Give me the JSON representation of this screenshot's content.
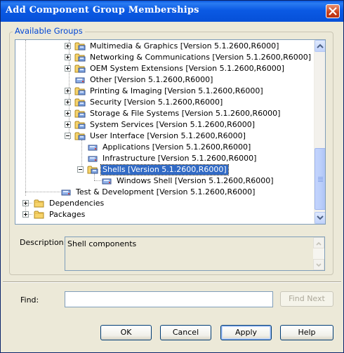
{
  "window": {
    "title": "Add Component Group Memberships"
  },
  "group": {
    "legend": "Available Groups"
  },
  "tree": {
    "items": [
      {
        "label": "Multimedia & Graphics [Version 5.1.2600,R6000]",
        "expander": "plus",
        "icon": "folder-component-icon"
      },
      {
        "label": "Networking & Communications [Version 5.1.2600,R6000]",
        "expander": "plus",
        "icon": "folder-component-icon"
      },
      {
        "label": "OEM System Extensions [Version 5.1.2600,R6000]",
        "expander": "plus",
        "icon": "folder-component-icon"
      },
      {
        "label": "Other [Version 5.1.2600,R6000]",
        "expander": "none",
        "icon": "component-icon"
      },
      {
        "label": "Printing & Imaging [Version 5.1.2600,R6000]",
        "expander": "plus",
        "icon": "folder-component-icon"
      },
      {
        "label": "Security [Version 5.1.2600,R6000]",
        "expander": "plus",
        "icon": "folder-component-icon"
      },
      {
        "label": "Storage & File Systems [Version 5.1.2600,R6000]",
        "expander": "plus",
        "icon": "folder-component-icon"
      },
      {
        "label": "System Services [Version 5.1.2600,R6000]",
        "expander": "plus",
        "icon": "folder-component-icon"
      },
      {
        "label": "User Interface [Version 5.1.2600,R6000]",
        "expander": "minus",
        "icon": "folder-component-icon"
      },
      {
        "label": "Applications [Version 5.1.2600,R6000]",
        "expander": "none",
        "icon": "component-icon"
      },
      {
        "label": "Infrastructure [Version 5.1.2600,R6000]",
        "expander": "none",
        "icon": "component-icon"
      },
      {
        "label": "Shells [Version 5.1.2600,R6000]",
        "expander": "minus",
        "icon": "folder-component-icon",
        "selected": true
      },
      {
        "label": "Windows Shell [Version 5.1.2600,R6000]",
        "expander": "none",
        "icon": "component-icon"
      },
      {
        "label": "Test & Development [Version 5.1.2600,R6000]",
        "expander": "none",
        "icon": "component-icon"
      },
      {
        "label": "Dependencies",
        "expander": "plus",
        "icon": "folder-icon"
      },
      {
        "label": "Packages",
        "expander": "plus",
        "icon": "folder-icon"
      }
    ]
  },
  "description": {
    "label": "Description:",
    "value": "Shell components"
  },
  "find": {
    "label": "Find:",
    "value": "",
    "next_label": "Find Next"
  },
  "buttons": {
    "ok": "OK",
    "cancel": "Cancel",
    "apply": "Apply",
    "help": "Help"
  },
  "colors": {
    "titlebar": "#0650d8",
    "selection": "#316ac5",
    "legend": "#0046d5"
  }
}
